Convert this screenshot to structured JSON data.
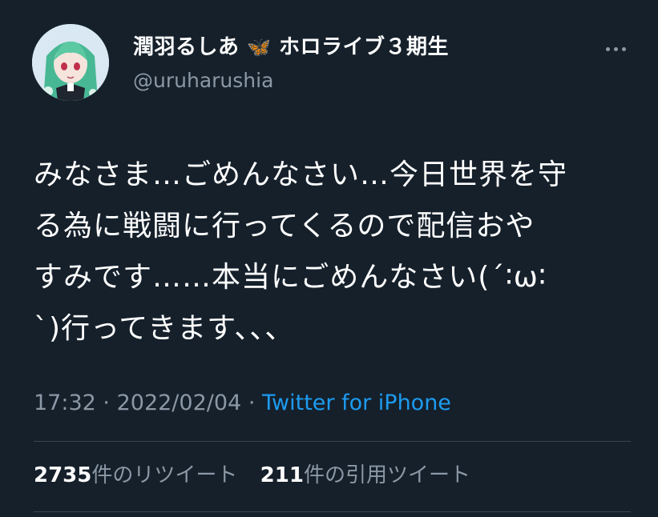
{
  "author": {
    "display_name": "潤羽るしあ",
    "display_emoji": "🦋",
    "display_suffix": "ホロライブ３期生",
    "handle": "@uruharushia"
  },
  "tweet": {
    "lines": [
      "みなさま…ごめんなさい…今日世界を守",
      "る為に戦闘に行ってくるので配信おや",
      "すみです……本当にごめんなさい(´∶ω∶",
      "`)行ってきます、、、"
    ]
  },
  "meta": {
    "time": "17:32",
    "separator": "·",
    "date": "2022/02/04",
    "source": "Twitter for iPhone"
  },
  "stats": {
    "retweets_count": "2735",
    "retweets_label": "件のリツイート",
    "quotes_count": "211",
    "quotes_label": "件の引用ツイート"
  },
  "colors": {
    "background": "#15202b",
    "secondary_text": "#8b98a5",
    "link": "#1d9bf0",
    "divider": "#38444d"
  }
}
